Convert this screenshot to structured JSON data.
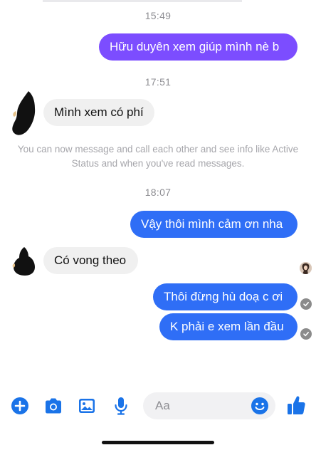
{
  "conversation": {
    "timestamps": [
      "15:49",
      "17:51",
      "18:07"
    ],
    "messages": [
      {
        "side": "out",
        "text": "Hữu duyên xem giúp mình nè b"
      },
      {
        "side": "in",
        "text": "Mình xem có phí"
      },
      {
        "side": "out",
        "text": "Vậy thôi mình cảm ơn nha"
      },
      {
        "side": "in",
        "text": "Có vong theo"
      },
      {
        "side": "out",
        "text": "Thôi đừng hù doạ c ơi"
      },
      {
        "side": "out",
        "text": "K phải e xem lần đầu"
      }
    ],
    "notice": "You can now message and call each other and see info like Active Status and when you've read messages."
  },
  "composer": {
    "placeholder": "Aa",
    "icons": [
      "plus-icon",
      "camera-icon",
      "image-icon",
      "microphone-icon",
      "emoji-icon",
      "thumbs-up-icon"
    ]
  },
  "colors": {
    "accent": "#2f6ef6",
    "first_bubble": "#7c4dff",
    "incoming_bubble": "#f0f0f0",
    "icon_blue": "#1a73e8"
  }
}
